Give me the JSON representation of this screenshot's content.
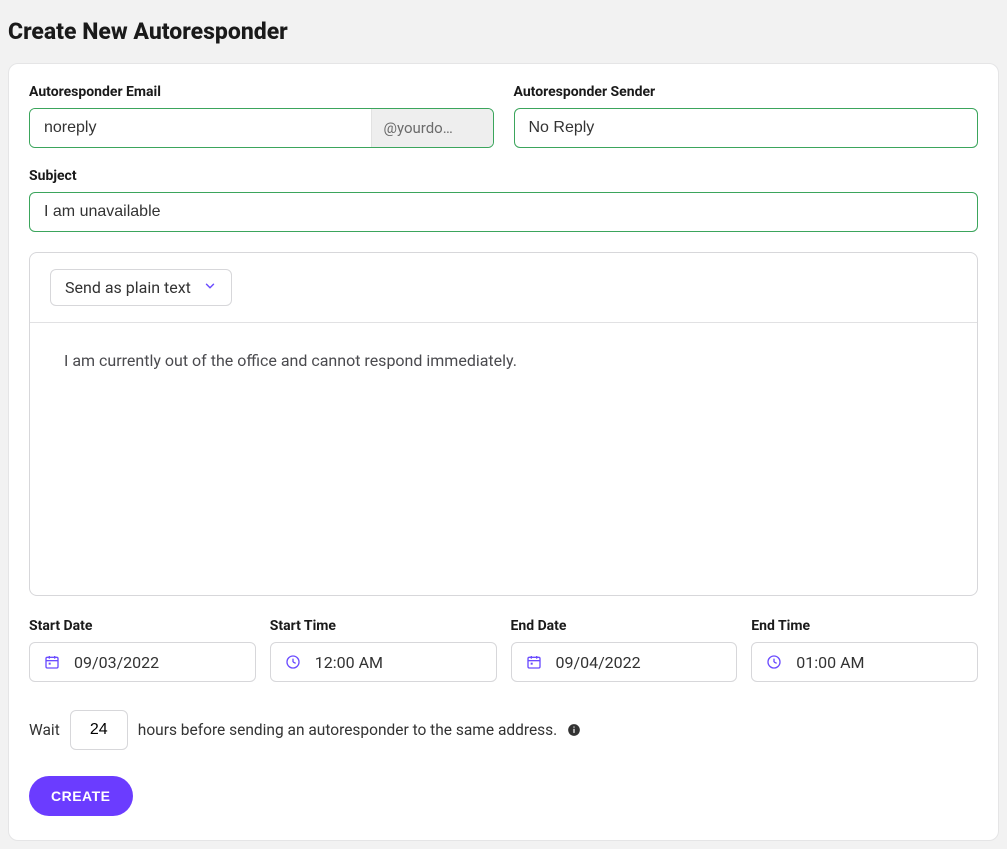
{
  "page": {
    "title": "Create New Autoresponder"
  },
  "form": {
    "email": {
      "label": "Autoresponder Email",
      "value": "noreply",
      "domainSuffix": "@yourdo…"
    },
    "sender": {
      "label": "Autoresponder Sender",
      "value": "No Reply"
    },
    "subject": {
      "label": "Subject",
      "value": "I am unavailable"
    },
    "format": {
      "selected": "Send as plain text"
    },
    "body": {
      "value": "I am currently out of the office and cannot respond immediately."
    },
    "startDate": {
      "label": "Start Date",
      "value": "09/03/2022"
    },
    "startTime": {
      "label": "Start Time",
      "value": "12:00 AM"
    },
    "endDate": {
      "label": "End Date",
      "value": "09/04/2022"
    },
    "endTime": {
      "label": "End Time",
      "value": "01:00 AM"
    },
    "wait": {
      "prefix": "Wait",
      "hours": "24",
      "suffix": "hours before sending an autoresponder to the same address."
    },
    "createButton": "CREATE"
  }
}
